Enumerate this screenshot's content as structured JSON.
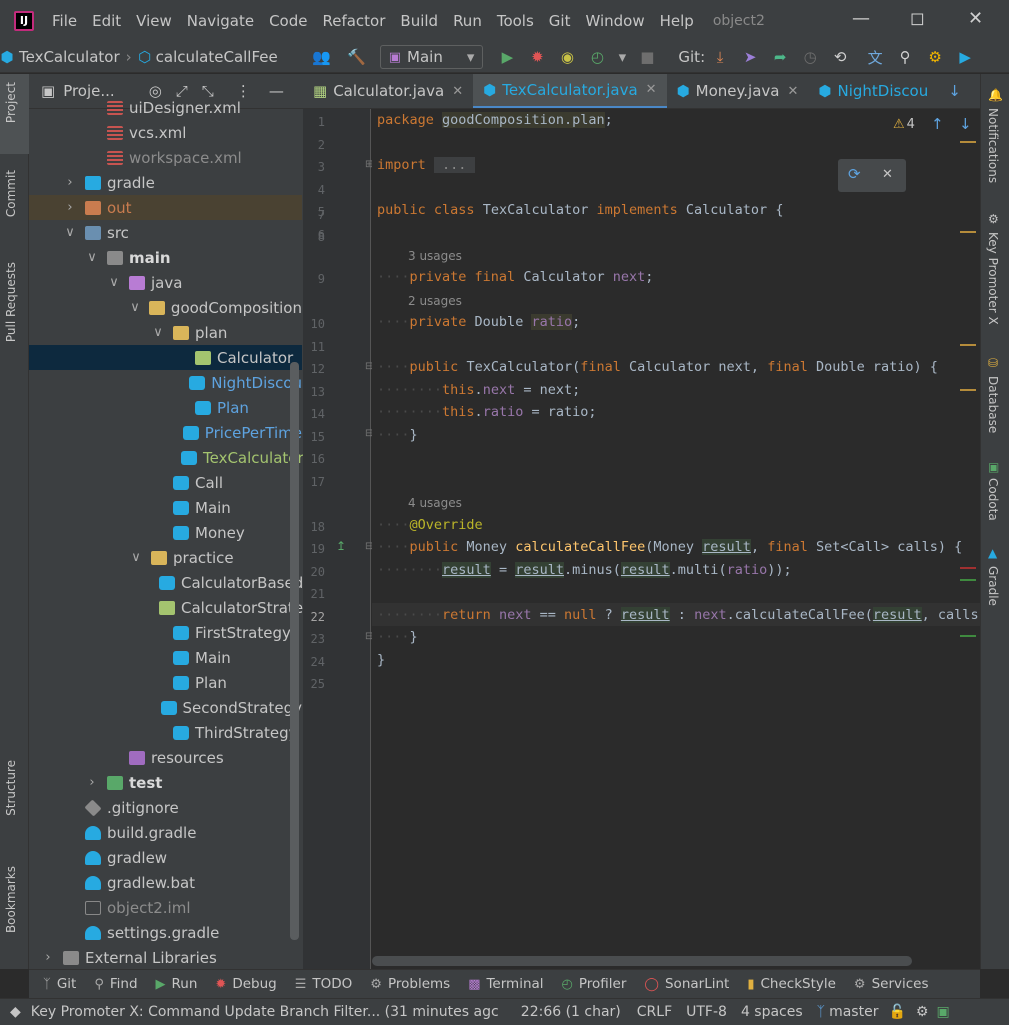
{
  "menubar": {
    "items": [
      "File",
      "Edit",
      "View",
      "Navigate",
      "Code",
      "Refactor",
      "Build",
      "Run",
      "Tools",
      "Git",
      "Window",
      "Help"
    ],
    "project": "object2"
  },
  "toolbar": {
    "breadcrumb_file": "TexCalculator",
    "breadcrumb_method": "calculateCallFee",
    "run_config": "Main",
    "git_label": "Git:"
  },
  "project_panel": {
    "title": "Proje...",
    "tree": [
      {
        "label": "uiDesigner.xml",
        "depth": 3,
        "icon": "xml",
        "color": "#c6c6c6"
      },
      {
        "label": "vcs.xml",
        "depth": 3,
        "icon": "xml",
        "color": "#c6c6c6"
      },
      {
        "label": "workspace.xml",
        "depth": 3,
        "icon": "xml",
        "color": "#8c8c8c"
      },
      {
        "label": "gradle",
        "depth": 2,
        "icon": "folder-gradle",
        "arrow": "right",
        "color": "#c6c6c6"
      },
      {
        "label": "out",
        "depth": 2,
        "icon": "folder-out",
        "arrow": "right",
        "color": "#c97c4f"
      },
      {
        "label": "src",
        "depth": 2,
        "icon": "folder-src",
        "arrow": "down",
        "color": "#c6c6c6"
      },
      {
        "label": "main",
        "depth": 3,
        "icon": "folder",
        "arrow": "down",
        "color": "#d9d9d9",
        "bold": true
      },
      {
        "label": "java",
        "depth": 4,
        "icon": "folder-java",
        "arrow": "down",
        "color": "#c6c6c6"
      },
      {
        "label": "goodComposition",
        "depth": 5,
        "icon": "package",
        "arrow": "down",
        "color": "#c6c6c6"
      },
      {
        "label": "plan",
        "depth": 6,
        "icon": "package",
        "arrow": "down",
        "color": "#c6c6c6"
      },
      {
        "label": "Calculator",
        "depth": 7,
        "icon": "interface",
        "color": "#c6c6c6",
        "selected": true
      },
      {
        "label": "NightDiscou",
        "depth": 7,
        "icon": "class",
        "color": "#5ea3e0"
      },
      {
        "label": "Plan",
        "depth": 7,
        "icon": "class",
        "color": "#5ea3e0"
      },
      {
        "label": "PricePerTime",
        "depth": 7,
        "icon": "class",
        "color": "#5ea3e0"
      },
      {
        "label": "TexCalculator",
        "depth": 7,
        "icon": "class",
        "color": "#a4c46f"
      },
      {
        "label": "Call",
        "depth": 6,
        "icon": "class",
        "color": "#c6c6c6"
      },
      {
        "label": "Main",
        "depth": 6,
        "icon": "class",
        "color": "#c6c6c6"
      },
      {
        "label": "Money",
        "depth": 6,
        "icon": "class",
        "color": "#c6c6c6"
      },
      {
        "label": "practice",
        "depth": 5,
        "icon": "package",
        "arrow": "down",
        "color": "#c6c6c6"
      },
      {
        "label": "CalculatorBased",
        "depth": 6,
        "icon": "class",
        "color": "#c6c6c6"
      },
      {
        "label": "CalculatorStrate",
        "depth": 6,
        "icon": "interface",
        "color": "#c6c6c6"
      },
      {
        "label": "FirstStrategy",
        "depth": 6,
        "icon": "class",
        "color": "#c6c6c6"
      },
      {
        "label": "Main",
        "depth": 6,
        "icon": "class",
        "color": "#c6c6c6"
      },
      {
        "label": "Plan",
        "depth": 6,
        "icon": "class",
        "color": "#c6c6c6"
      },
      {
        "label": "SecondStrategy",
        "depth": 6,
        "icon": "class",
        "color": "#c6c6c6"
      },
      {
        "label": "ThirdStrategy",
        "depth": 6,
        "icon": "class",
        "color": "#c6c6c6"
      },
      {
        "label": "resources",
        "depth": 4,
        "icon": "folder-res",
        "color": "#c6c6c6"
      },
      {
        "label": "test",
        "depth": 3,
        "icon": "folder-test",
        "arrow": "right",
        "color": "#d9d9d9",
        "bold": true
      },
      {
        "label": ".gitignore",
        "depth": 2,
        "icon": "git",
        "color": "#c6c6c6"
      },
      {
        "label": "build.gradle",
        "depth": 2,
        "icon": "gradle",
        "color": "#c6c6c6"
      },
      {
        "label": "gradlew",
        "depth": 2,
        "icon": "gradle",
        "color": "#c6c6c6"
      },
      {
        "label": "gradlew.bat",
        "depth": 2,
        "icon": "gradle",
        "color": "#c6c6c6"
      },
      {
        "label": "object2.iml",
        "depth": 2,
        "icon": "iml",
        "color": "#8c8c8c"
      },
      {
        "label": "settings.gradle",
        "depth": 2,
        "icon": "gradle",
        "color": "#c6c6c6"
      },
      {
        "label": "External Libraries",
        "depth": 1,
        "icon": "lib",
        "arrow": "right",
        "color": "#c6c6c6"
      }
    ]
  },
  "left_strip": {
    "tabs": [
      "Project",
      "Commit",
      "Pull Requests",
      "Structure",
      "Bookmarks"
    ]
  },
  "right_strip": {
    "tabs": [
      "Notifications",
      "Key Promoter X",
      "Database",
      "Codota",
      "Gradle"
    ]
  },
  "editor_tabs": [
    {
      "label": "Calculator.java",
      "icon": "interface",
      "closable": true
    },
    {
      "label": "TexCalculator.java",
      "icon": "class",
      "closable": true,
      "active": true
    },
    {
      "label": "Money.java",
      "icon": "class",
      "closable": true
    },
    {
      "label": "NightDiscou",
      "icon": "class",
      "closable": false
    }
  ],
  "editor": {
    "warning_count": "4",
    "line_numbers": [
      "1",
      "2",
      "3",
      "4",
      "5",
      "6",
      "7",
      "8",
      "9",
      "10",
      "11",
      "12",
      "13",
      "14",
      "15",
      "16",
      "17",
      "18",
      "19",
      "20",
      "21",
      "22",
      "23",
      "24",
      "25"
    ],
    "hints": {
      "usages_3": "3 usages",
      "usages_2": "2 usages",
      "usages_4": "4 usages"
    }
  },
  "bottom_tools": [
    "Git",
    "Find",
    "Run",
    "Debug",
    "TODO",
    "Problems",
    "Terminal",
    "Profiler",
    "SonarLint",
    "CheckStyle",
    "Services"
  ],
  "status": {
    "message": "Key Promoter X: Command Update Branch Filter... (31 minutes agc",
    "position": "22:66 (1 char)",
    "line_ending": "CRLF",
    "encoding": "UTF-8",
    "indent": "4 spaces",
    "branch": "master"
  },
  "colors": {
    "accent": "#27aae1",
    "keyword": "#cc7832",
    "field": "#9876aa",
    "method": "#ffc66d",
    "annotation": "#bbb529"
  }
}
